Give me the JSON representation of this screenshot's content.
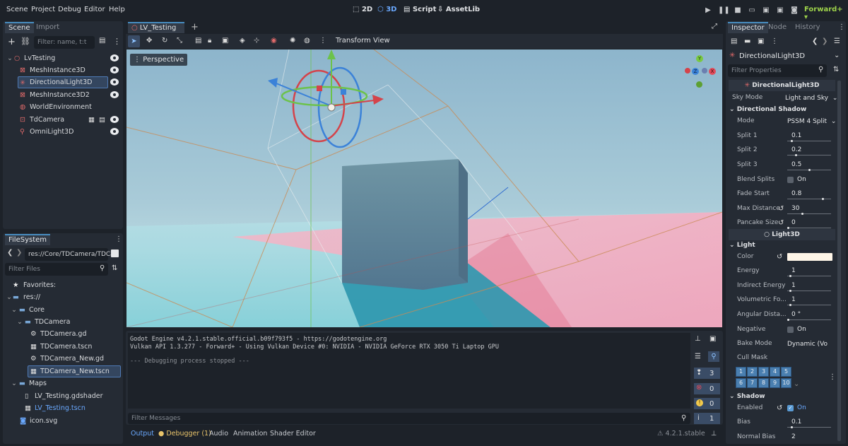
{
  "menu": [
    "Scene",
    "Project",
    "Debug",
    "Editor",
    "Help"
  ],
  "workspaces": {
    "w2d": "2D",
    "w3d": "3D",
    "script": "Script",
    "assetlib": "AssetLib"
  },
  "renderer": "Forward+",
  "scene_dock": {
    "tabs": [
      "Scene",
      "Import"
    ],
    "filter_placeholder": "Filter: name, t:t",
    "tree": [
      "LvTesting",
      "MeshInstance3D",
      "DirectionalLight3D",
      "MeshInstance3D2",
      "WorldEnvironment",
      "TdCamera",
      "OmniLight3D"
    ]
  },
  "filesystem": {
    "tab": "FileSystem",
    "path": "res://Core/TDCamera/TDCa",
    "filter_placeholder": "Filter Files",
    "items": [
      "Favorites:",
      "res://",
      "Core",
      "TDCamera",
      "TDCamera.gd",
      "TDCamera.tscn",
      "TDCamera_New.gd",
      "TDCamera_New.tscn",
      "Maps",
      "LV_Testing.gdshader",
      "LV_Testing.tscn",
      "icon.svg"
    ]
  },
  "editor_tabs": {
    "scene_tab": "LV_Testing",
    "transform": "Transform",
    "view": "View"
  },
  "viewport": {
    "perspective": "Perspective",
    "gizmo": {
      "y": "Y",
      "z": "Z",
      "x": "X"
    }
  },
  "output": {
    "lines": [
      "Godot Engine v4.2.1.stable.official.b09f793f5 - https://godotengine.org",
      "Vulkan API 1.3.277 - Forward+ - Using Vulkan Device #0: NVIDIA - NVIDIA GeForce RTX 3050 Ti Laptop GPU",
      "",
      "--- Debugging process stopped ---"
    ],
    "filter_placeholder": "Filter Messages",
    "counts": {
      "messages": "3",
      "errors": "0",
      "warnings": "0",
      "info": "1"
    }
  },
  "bottom_tabs": [
    "Output",
    "Debugger (1)",
    "Audio",
    "Animation",
    "Shader Editor"
  ],
  "version": "4.2.1.stable",
  "inspector": {
    "tabs": [
      "Inspector",
      "Node",
      "History"
    ],
    "object": "DirectionalLight3D",
    "filter_placeholder": "Filter Properties",
    "class_header": "DirectionalLight3D",
    "sky_mode": {
      "label": "Sky Mode",
      "value": "Light and Sky"
    },
    "directional_shadow": {
      "title": "Directional Shadow",
      "props": [
        {
          "label": "Mode",
          "value": "PSSM 4 Split"
        },
        {
          "label": "Split 1",
          "value": "0.1"
        },
        {
          "label": "Split 2",
          "value": "0.2"
        },
        {
          "label": "Split 3",
          "value": "0.5"
        },
        {
          "label": "Blend Splits",
          "value": "On"
        },
        {
          "label": "Fade Start",
          "value": "0.8"
        },
        {
          "label": "Max Distance",
          "value": "30"
        },
        {
          "label": "Pancake Size",
          "value": "0"
        }
      ]
    },
    "light3d_header": "Light3D",
    "light": {
      "title": "Light",
      "props": [
        {
          "label": "Color",
          "value": ""
        },
        {
          "label": "Energy",
          "value": "1"
        },
        {
          "label": "Indirect Energy",
          "value": "1"
        },
        {
          "label": "Volumetric Fo...",
          "value": "1"
        },
        {
          "label": "Angular Dista...",
          "value": "0 °"
        },
        {
          "label": "Negative",
          "value": "On"
        },
        {
          "label": "Bake Mode",
          "value": "Dynamic (Vo"
        },
        {
          "label": "Cull Mask",
          "value": ""
        }
      ]
    },
    "cull_mask": [
      "1",
      "2",
      "3",
      "4",
      "5",
      "6",
      "7",
      "8",
      "9",
      "10"
    ],
    "shadow": {
      "title": "Shadow",
      "props": [
        {
          "label": "Enabled",
          "value": "On"
        },
        {
          "label": "Bias",
          "value": "0.1"
        },
        {
          "label": "Normal Bias",
          "value": "2"
        }
      ]
    }
  },
  "colors": {
    "accent": "#478cbf",
    "light_color": "#fff6e8",
    "renderer": "#9ed34a"
  }
}
